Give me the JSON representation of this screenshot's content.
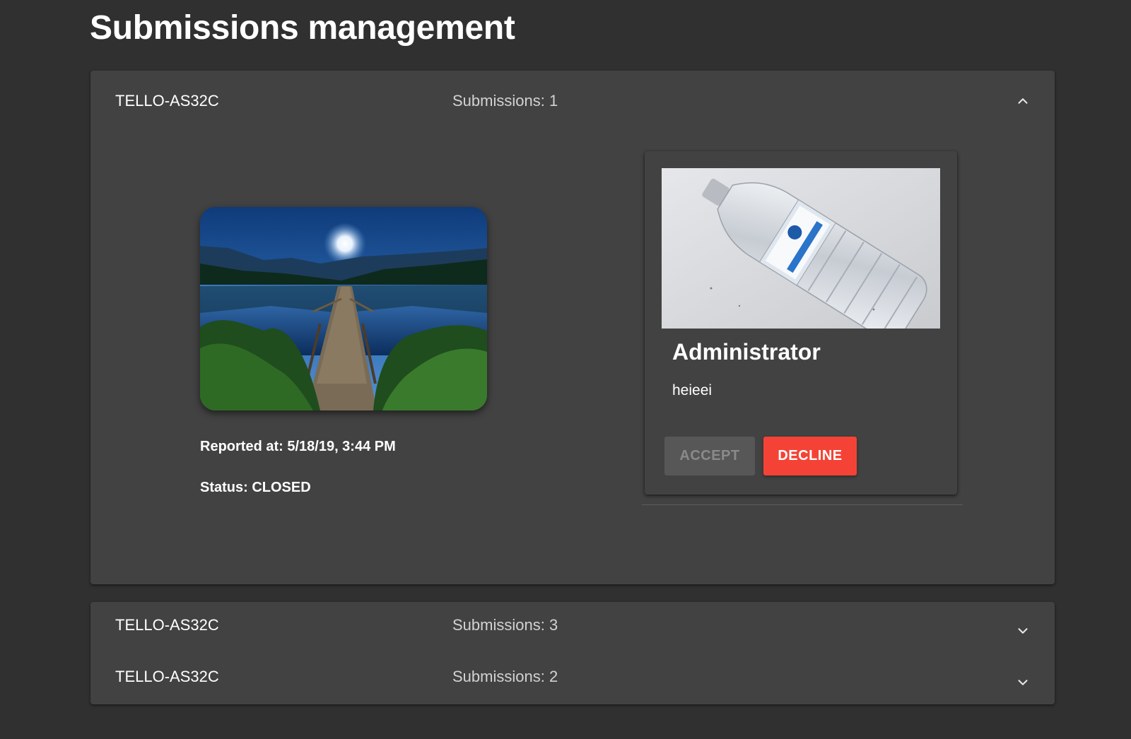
{
  "page": {
    "title": "Submissions management"
  },
  "panels": [
    {
      "device_id": "TELLO-AS32C",
      "submissions_label": "Submissions: 1",
      "expanded": true,
      "report": {
        "reported_at": "Reported at: 5/18/19, 3:44 PM",
        "status": "Status: CLOSED",
        "image": "lake-pier-night-photo"
      },
      "submission": {
        "image": "plastic-water-bottle-photo",
        "author": "Administrator",
        "text": "heieei",
        "accept_label": "ACCEPT",
        "decline_label": "DECLINE"
      }
    },
    {
      "device_id": "TELLO-AS32C",
      "submissions_label": "Submissions: 3",
      "expanded": false
    },
    {
      "device_id": "TELLO-AS32C",
      "submissions_label": "Submissions: 2",
      "expanded": false
    }
  ],
  "icons": {
    "expanded": "chevron-up-icon",
    "collapsed": "chevron-down-icon"
  },
  "colors": {
    "background": "#303030",
    "panel": "#424242",
    "decline": "#f44336",
    "accept_disabled": "#575757"
  }
}
